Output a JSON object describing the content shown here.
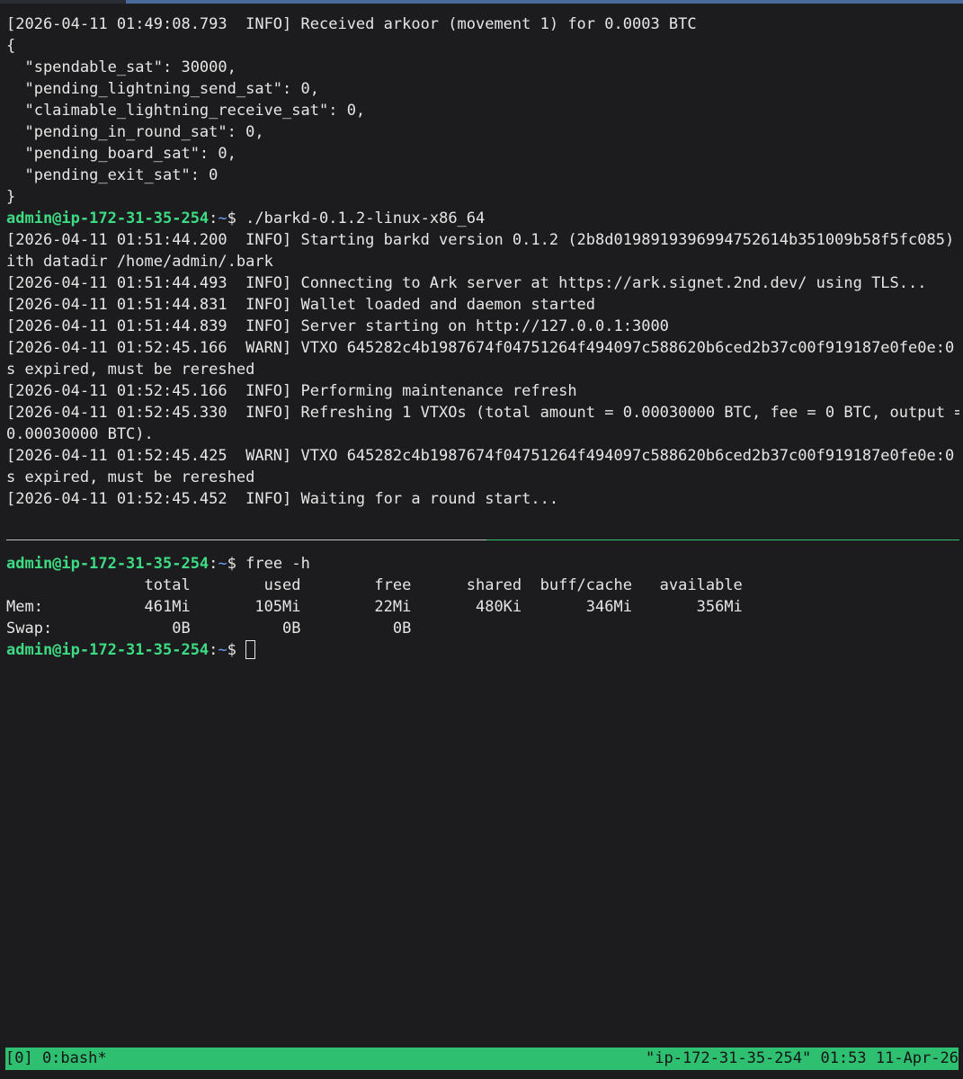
{
  "terminal": {
    "prompt": {
      "user_host": "admin@ip-172-31-35-254",
      "colon": ":",
      "path": "~",
      "dollar": "$ "
    },
    "top_pane": {
      "lines": [
        "[2026-04-11 01:49:08.793  INFO] Received arkoor (movement 1) for 0.0003 BTC",
        "{",
        "  \"spendable_sat\": 30000,",
        "  \"pending_lightning_send_sat\": 0,",
        "  \"claimable_lightning_receive_sat\": 0,",
        "  \"pending_in_round_sat\": 0,",
        "  \"pending_board_sat\": 0,",
        "  \"pending_exit_sat\": 0",
        "}"
      ],
      "command": "./barkd-0.1.2-linux-x86_64",
      "output": [
        "[2026-04-11 01:51:44.200  INFO] Starting barkd version 0.1.2 (2b8d0198919396994752614b351009b58f5fc085) w",
        "ith datadir /home/admin/.bark",
        "[2026-04-11 01:51:44.493  INFO] Connecting to Ark server at https://ark.signet.2nd.dev/ using TLS...",
        "[2026-04-11 01:51:44.831  INFO] Wallet loaded and daemon started",
        "[2026-04-11 01:51:44.839  INFO] Server starting on http://127.0.0.1:3000",
        "[2026-04-11 01:52:45.166  WARN] VTXO 645282c4b1987674f04751264f494097c588620b6ced2b37c00f919187e0fe0e:0 i",
        "s expired, must be rereshed",
        "[2026-04-11 01:52:45.166  INFO] Performing maintenance refresh",
        "[2026-04-11 01:52:45.330  INFO] Refreshing 1 VTXOs (total amount = 0.00030000 BTC, fee = 0 BTC, output =",
        "0.00030000 BTC).",
        "[2026-04-11 01:52:45.425  WARN] VTXO 645282c4b1987674f04751264f494097c588620b6ced2b37c00f919187e0fe0e:0 i",
        "s expired, must be rereshed",
        "[2026-04-11 01:52:45.452  INFO] Waiting for a round start..."
      ]
    },
    "bottom_pane": {
      "command": "free -h",
      "output": [
        "               total        used        free      shared  buff/cache   available",
        "Mem:           461Mi       105Mi        22Mi       480Ki       346Mi       356Mi",
        "Swap:             0B          0B          0B"
      ]
    }
  },
  "statusbar": {
    "left": "[0] 0:bash*",
    "right": "\"ip-172-31-35-254\" 01:53 11-Apr-26"
  },
  "colors": {
    "background": "#1c1c1e",
    "prompt_user": "#3ddc84",
    "prompt_path": "#6c9ef8",
    "statusbar": "#2fbf71",
    "active_divider": "#2fbf71"
  }
}
